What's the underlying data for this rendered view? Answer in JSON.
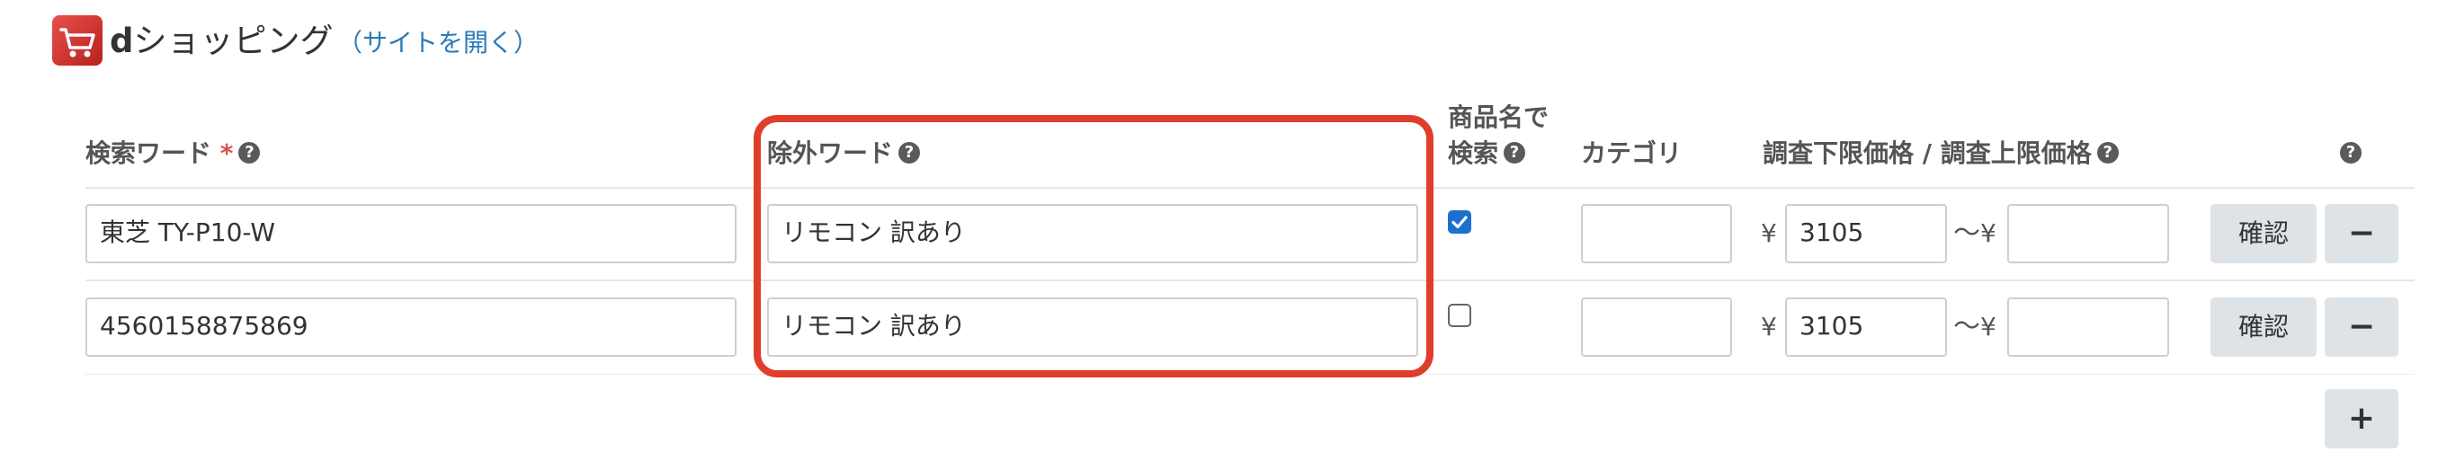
{
  "header": {
    "brand_bold": "d",
    "brand_rest": "ショッピング",
    "site_link": "（サイトを開く）"
  },
  "columns": {
    "search_word": "検索ワード",
    "required_mark": "*",
    "exclude_word": "除外ワード",
    "name_search_line1": "商品名で",
    "name_search_line2": "検索",
    "category": "カテゴリ",
    "price_range": "調査下限価格 / 調査上限価格",
    "help_glyph": "?"
  },
  "rows": [
    {
      "search_word": "東芝 TY-P10-W",
      "exclude_word": "リモコン 訳あり",
      "name_search_checked": true,
      "category": "",
      "currency": "¥",
      "price_min": "3105",
      "separator": "〜",
      "price_max": "",
      "confirm_label": "確認",
      "remove_label": "−"
    },
    {
      "search_word": "4560158875869",
      "exclude_word": "リモコン 訳あり",
      "name_search_checked": false,
      "category": "",
      "currency": "¥",
      "price_min": "3105",
      "separator": "〜",
      "price_max": "",
      "confirm_label": "確認",
      "remove_label": "−"
    }
  ],
  "add_label": "+",
  "colors": {
    "highlight": "#e03e2a",
    "link": "#2b7bb9",
    "button_bg": "#dde3e7",
    "checkbox_checked": "#1f6fd1",
    "required": "#d9534f"
  }
}
